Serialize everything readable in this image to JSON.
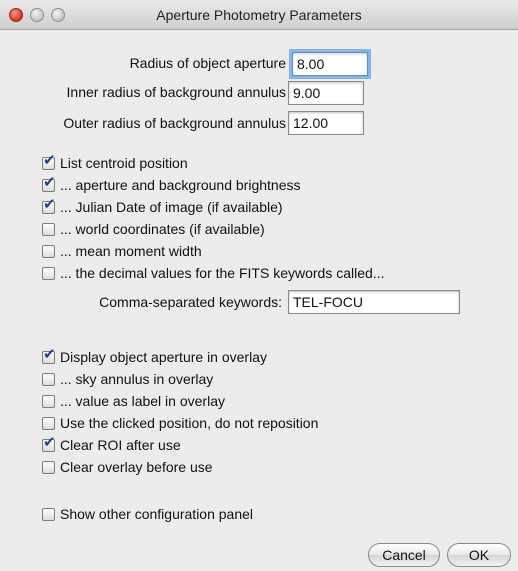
{
  "window": {
    "title": "Aperture Photometry Parameters"
  },
  "params": [
    {
      "label": "Radius of object aperture",
      "value": "8.00"
    },
    {
      "label": "Inner radius of background annulus",
      "value": "9.00"
    },
    {
      "label": "Outer radius of background annulus",
      "value": "12.00"
    }
  ],
  "checkboxes": [
    {
      "label": "List centroid position",
      "checked": true
    },
    {
      "label": "... aperture and background brightness",
      "checked": true
    },
    {
      "label": "... Julian Date of image (if available)",
      "checked": true
    },
    {
      "label": "... world coordinates (if available)",
      "checked": false
    },
    {
      "label": "... mean moment width",
      "checked": false
    },
    {
      "label": "... the decimal values for the FITS keywords called...",
      "checked": false
    }
  ],
  "keywords": {
    "label": "Comma-separated keywords:",
    "value": "TEL-FOCU"
  },
  "overlay_checkboxes": [
    {
      "label": "Display object aperture in overlay",
      "checked": true
    },
    {
      "label": "... sky annulus in overlay",
      "checked": false
    },
    {
      "label": "... value as label in overlay",
      "checked": false
    },
    {
      "label": "Use the clicked position, do not reposition",
      "checked": false
    },
    {
      "label": "Clear ROI after use",
      "checked": true
    },
    {
      "label": "Clear overlay before use",
      "checked": false
    }
  ],
  "other_panel": {
    "label": "Show other configuration panel",
    "checked": false
  },
  "buttons": {
    "cancel": "Cancel",
    "ok": "OK"
  },
  "check_glyph": "✔"
}
